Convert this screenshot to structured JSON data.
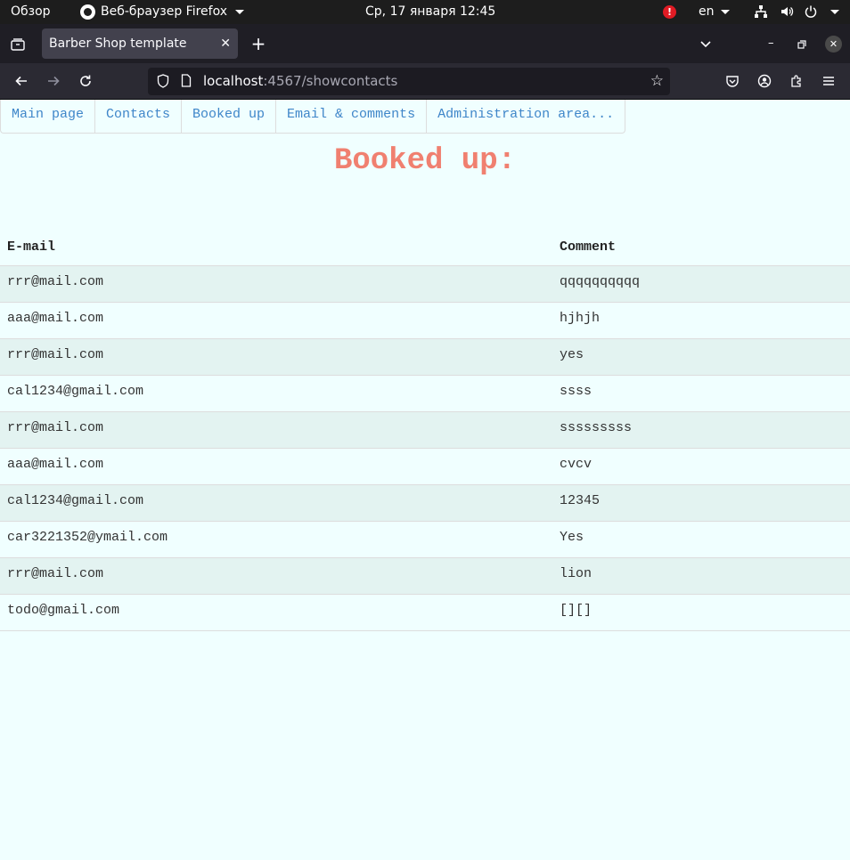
{
  "system_bar": {
    "activities": "Обзор",
    "app_name": "Веб-браузер Firefox",
    "clock": "Ср, 17 января  12:45",
    "alert": "!",
    "language": "en",
    "icons": [
      "network-icon",
      "volume-icon",
      "power-icon"
    ]
  },
  "browser": {
    "tab_title": "Barber Shop template",
    "url_host": "localhost",
    "url_rest": ":4567/showcontacts",
    "icons": [
      "back-icon",
      "forward-icon",
      "reload-icon",
      "shield-icon",
      "page-icon",
      "star-icon",
      "pocket-icon",
      "account-icon",
      "extensions-icon",
      "menu-icon"
    ]
  },
  "page": {
    "nav": [
      {
        "label": "Main page"
      },
      {
        "label": "Contacts"
      },
      {
        "label": "Booked up"
      },
      {
        "label": "Email & comments"
      },
      {
        "label": "Administration area..."
      }
    ],
    "heading": "Booked up:",
    "table": {
      "headers": [
        "E-mail",
        "Comment"
      ],
      "rows": [
        {
          "email": "rrr@mail.com",
          "comment": "qqqqqqqqqq"
        },
        {
          "email": "aaa@mail.com",
          "comment": "hjhjh"
        },
        {
          "email": "rrr@mail.com",
          "comment": "yes"
        },
        {
          "email": "cal1234@gmail.com",
          "comment": "ssss"
        },
        {
          "email": "rrr@mail.com",
          "comment": "sssssssss"
        },
        {
          "email": "aaa@mail.com",
          "comment": "cvcv"
        },
        {
          "email": "cal1234@gmail.com",
          "comment": "12345"
        },
        {
          "email": "car3221352@ymail.com",
          "comment": "Yes"
        },
        {
          "email": "rrr@mail.com",
          "comment": "lion"
        },
        {
          "email": "todo@gmail.com",
          "comment": "[][]"
        }
      ]
    }
  },
  "colors": {
    "page_background": "#f0ffff",
    "heading": "#f08070",
    "link": "#3f86c9",
    "stripe": "#e3f3f1"
  }
}
